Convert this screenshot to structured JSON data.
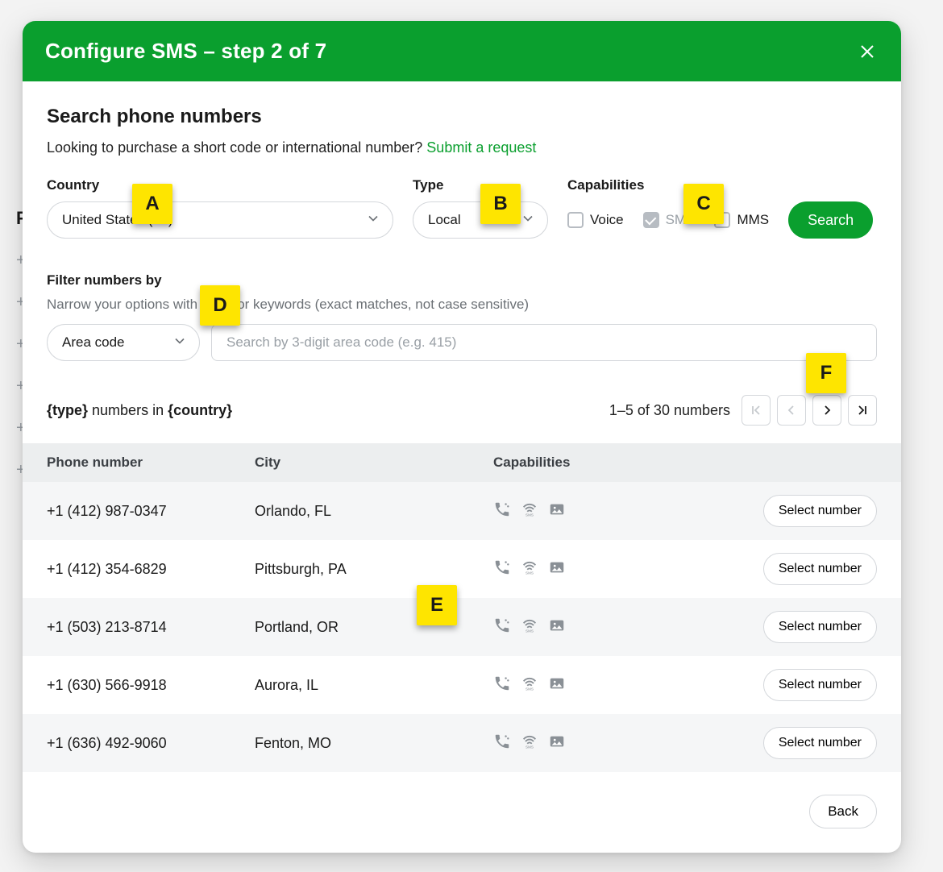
{
  "header": {
    "title": "Configure SMS – step 2 of 7"
  },
  "section": {
    "title": "Search phone numbers",
    "intro_prefix": "Looking to purchase a short code or international number? ",
    "intro_link": "Submit a request"
  },
  "fields": {
    "country_label": "Country",
    "country_value": "United States (+1)",
    "type_label": "Type",
    "type_value": "Local",
    "capabilities_label": "Capabilities",
    "cap_voice": "Voice",
    "cap_sms": "SMS",
    "cap_mms": "MMS",
    "search_button": "Search"
  },
  "filter": {
    "label": "Filter numbers by",
    "hint": "Narrow your options with digits or keywords (exact matches, not case sensitive)",
    "mode": "Area code",
    "placeholder": "Search by 3-digit area code (e.g. 415)"
  },
  "listing": {
    "title_html": "{type} numbers in {country}",
    "pager_text": "1–5 of 30 numbers"
  },
  "columns": {
    "number": "Phone number",
    "city": "City",
    "capabilities": "Capabilities"
  },
  "rows": [
    {
      "number": "+1 (412) 987-0347",
      "city": "Orlando, FL"
    },
    {
      "number": "+1 (412) 354-6829",
      "city": "Pittsburgh, PA"
    },
    {
      "number": "+1 (503) 213-8714",
      "city": "Portland, OR"
    },
    {
      "number": "+1 (630) 566-9918",
      "city": "Aurora, IL"
    },
    {
      "number": "+1 (636) 492-9060",
      "city": "Fenton, MO"
    }
  ],
  "select_button": "Select number",
  "back_button": "Back",
  "annotations": [
    "A",
    "B",
    "C",
    "D",
    "E",
    "F"
  ],
  "bg_char": "+",
  "bg_label": "P"
}
